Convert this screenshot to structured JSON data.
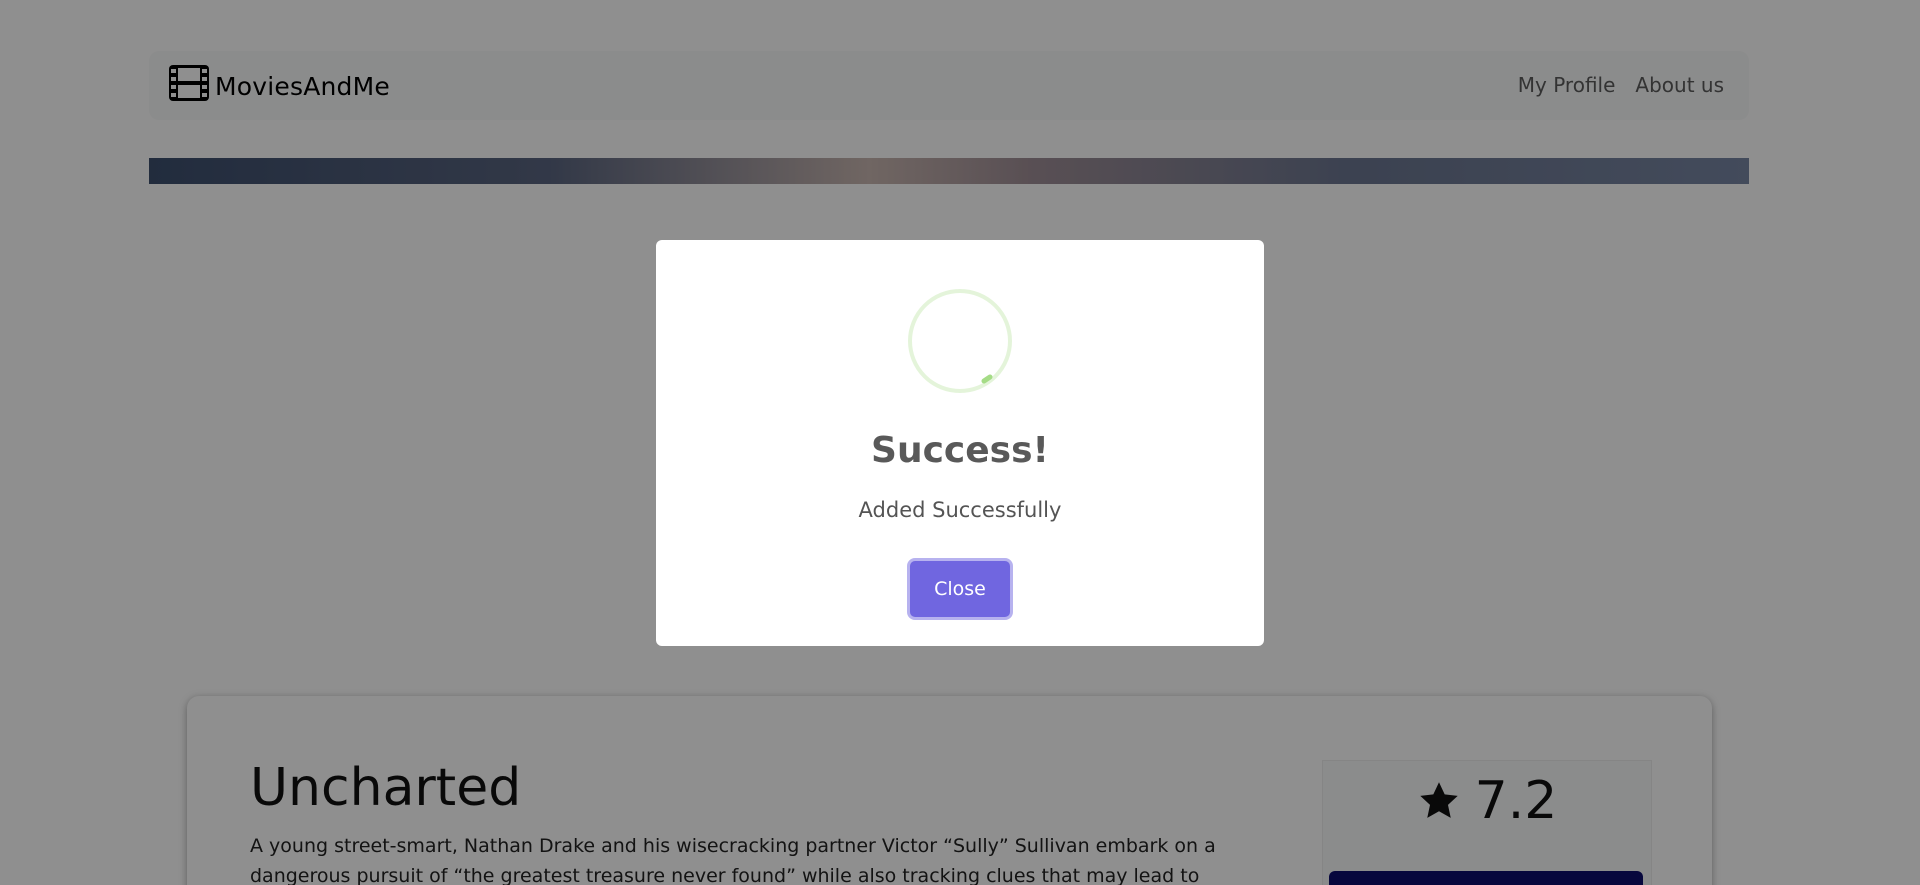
{
  "navbar": {
    "brand": "MoviesAndMe",
    "links": [
      "My Profile",
      "About us"
    ]
  },
  "movie": {
    "title": "Uncharted",
    "overview": "A young street-smart, Nathan Drake and his wisecracking partner Victor “Sully” Sullivan embark on a dangerous pursuit of “the greatest treasure never found” while also tracking clues that may lead to",
    "rating": "7.2"
  },
  "modal": {
    "title": "Success!",
    "text": "Added Successfully",
    "close_label": "Close"
  },
  "colors": {
    "accent": "#7066e0",
    "success": "#a5dc86",
    "rating_button": "#0d0d6e"
  },
  "icons": {
    "brand": "film-icon",
    "rating": "star-icon",
    "modal": "success-icon"
  }
}
